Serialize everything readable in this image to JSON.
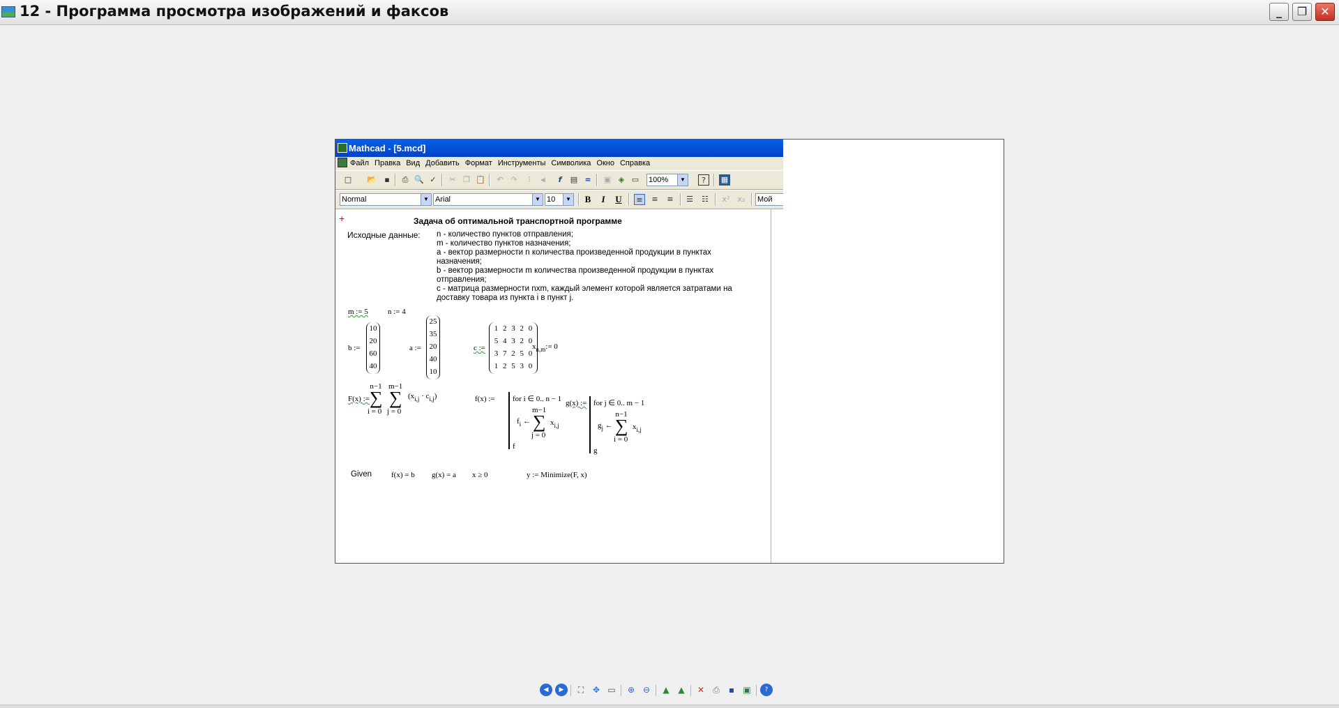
{
  "viewer": {
    "title": "12 - Программа просмотра изображений и факсов",
    "minimize": "_",
    "maximize": "❐",
    "close": "✕"
  },
  "mathcad": {
    "title": "Mathcad - [5.mcd]",
    "menu": [
      "Файл",
      "Правка",
      "Вид",
      "Добавить",
      "Формат",
      "Инструменты",
      "Символика",
      "Окно",
      "Справка"
    ],
    "zoom": "100%",
    "style": "Normal",
    "font": "Arial",
    "font_size": "10",
    "bold": "B",
    "italic": "I",
    "underline": "U",
    "resource_label": "Мой",
    "document": {
      "cursor": "+",
      "heading": "Задача об оптимальной транспортной программе",
      "source_label": "Исходные данные:",
      "source_lines": [
        "n - количество пунктов отправления;",
        "m - количество пунктов назначения;",
        "a - вектор размерности n количества произведенной продукции в пунктах",
        "назначения;",
        "b - вектор размерности m количества произведенной продукции в пунктах",
        "отправления;",
        "c - матрица размерности nxm, каждый элемент которой является затратами на",
        "доставку товара из пункта i в пункт j."
      ],
      "m_def": "m := 5",
      "n_def": "n := 4",
      "b_label": "b :=",
      "b_values": [
        "10",
        "20",
        "60",
        "40"
      ],
      "a_label": "a :=",
      "a_values": [
        "25",
        "35",
        "20",
        "40",
        "10"
      ],
      "c_label": "c :=",
      "c_rows": [
        [
          "1",
          "2",
          "3",
          "2",
          "0"
        ],
        [
          "5",
          "4",
          "3",
          "2",
          "0"
        ],
        [
          "3",
          "7",
          "2",
          "5",
          "0"
        ],
        [
          "1",
          "2",
          "5",
          "3",
          "0"
        ]
      ],
      "x_def": "x",
      "x_sub": "n,m",
      "x_val": ":= 0",
      "F_label": "F(x) :=",
      "F_sum1_top": "n−1",
      "F_sum1_bot": "i = 0",
      "F_sum2_top": "m−1",
      "F_sum2_bot": "j = 0",
      "F_body": "x",
      "F_body_sub": "i,j",
      "F_body2": "· c",
      "F_body2_sub": "i,j",
      "f_label": "f(x) :=",
      "f_for": "for  i ∈ 0.. n − 1",
      "f_lhs": "f",
      "f_lhs_sub": "i",
      "f_arrow": "←",
      "f_sum_top": "m−1",
      "f_sum_bot": "j = 0",
      "f_term": "x",
      "f_term_sub": "i,j",
      "f_return": "f",
      "g_label": "g(x) :=",
      "g_for": "for  j ∈ 0.. m − 1",
      "g_lhs": "g",
      "g_lhs_sub": "j",
      "g_arrow": "←",
      "g_sum_top": "n−1",
      "g_sum_bot": "i = 0",
      "g_term": "x",
      "g_term_sub": "i,j",
      "g_return": "g",
      "given": "Given",
      "c1": "f(x) = b",
      "c2": "g(x) = a",
      "c3": "x ≥ 0",
      "minimize": "y := Minimize(F, x)"
    }
  },
  "sum_symbol": "∑",
  "viewer_toolbar_icons": [
    "prev-image-icon",
    "next-image-icon",
    "best-fit-icon",
    "actual-size-icon",
    "slideshow-icon",
    "zoom-in-icon",
    "zoom-out-icon",
    "rotate-clockwise-icon",
    "rotate-counterclockwise-icon",
    "delete-icon",
    "print-icon",
    "save-icon",
    "edit-icon",
    "help-icon"
  ]
}
